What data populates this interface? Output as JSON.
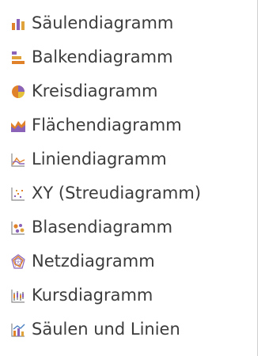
{
  "menu": {
    "items": [
      {
        "label": "Säulendiagramm",
        "icon": "column-chart-icon"
      },
      {
        "label": "Balkendiagramm",
        "icon": "bar-chart-icon"
      },
      {
        "label": "Kreisdiagramm",
        "icon": "pie-chart-icon"
      },
      {
        "label": "Flächendiagramm",
        "icon": "area-chart-icon"
      },
      {
        "label": "Liniendiagramm",
        "icon": "line-chart-icon"
      },
      {
        "label": "XY (Streudiagramm)",
        "icon": "scatter-chart-icon"
      },
      {
        "label": "Blasendiagramm",
        "icon": "bubble-chart-icon"
      },
      {
        "label": "Netzdiagramm",
        "icon": "net-chart-icon"
      },
      {
        "label": "Kursdiagramm",
        "icon": "stock-chart-icon"
      },
      {
        "label": "Säulen und Linien",
        "icon": "column-and-line-chart-icon"
      }
    ]
  }
}
